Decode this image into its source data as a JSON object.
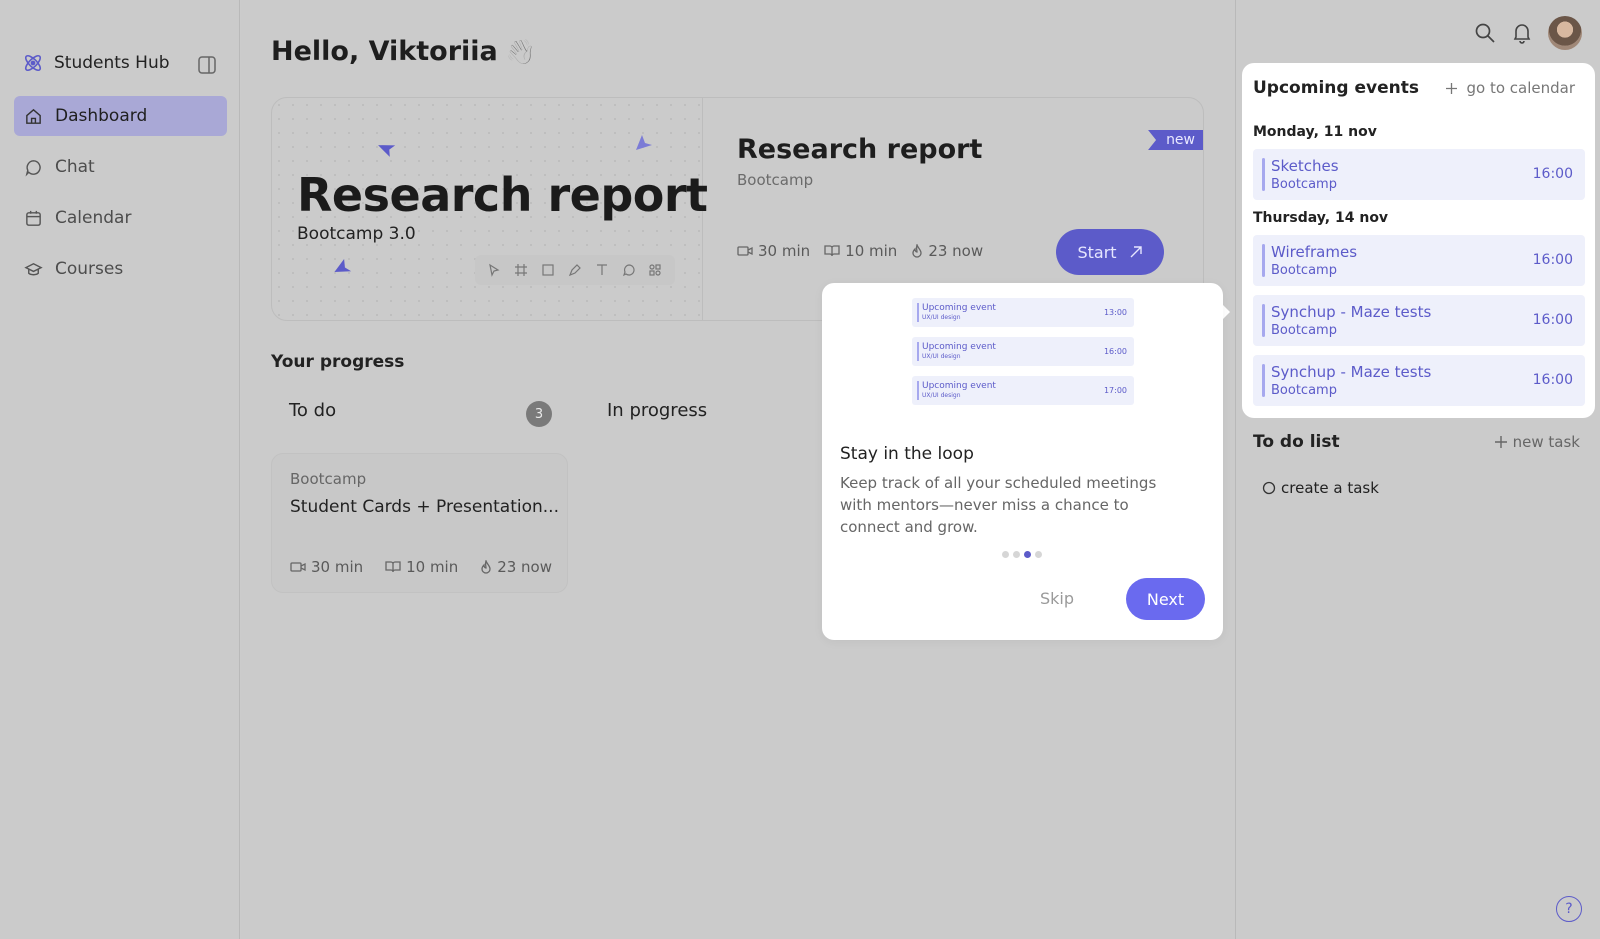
{
  "app": {
    "name": "Students Hub"
  },
  "sidebar": {
    "items": [
      {
        "label": "Dashboard",
        "icon": "home-icon",
        "active": true
      },
      {
        "label": "Chat",
        "icon": "chat-icon"
      },
      {
        "label": "Calendar",
        "icon": "calendar-icon"
      },
      {
        "label": "Courses",
        "icon": "graduation-cap-icon"
      }
    ]
  },
  "header": {
    "greeting": "Hello, Viktoriia",
    "emoji": "👋"
  },
  "hero": {
    "preview_title": "Research report",
    "preview_subtitle": "Bootcamp 3.0",
    "title": "Research report",
    "category": "Bootcamp",
    "badge": "new",
    "video_time": "30 min",
    "read_time": "10 min",
    "active_now": "23 now",
    "start_label": "Start"
  },
  "progress": {
    "title": "Your progress",
    "todo_label": "To do",
    "todo_count": "3",
    "in_progress_label": "In progress",
    "task": {
      "category": "Bootcamp",
      "title": "Student Cards + Presentation...",
      "video_time": "30 min",
      "read_time": "10 min",
      "active_now": "23 now"
    }
  },
  "events": {
    "title": "Upcoming events",
    "calendar_link": "go to calendar",
    "days": [
      {
        "label": "Monday, 11 nov"
      },
      {
        "label": "Thursday, 14 nov"
      }
    ],
    "items": [
      {
        "name": "Sketches",
        "sub": "Bootcamp",
        "time": "16:00"
      },
      {
        "name": "Wireframes",
        "sub": "Bootcamp",
        "time": "16:00"
      },
      {
        "name": "Synchup - Maze tests",
        "sub": "Bootcamp",
        "time": "16:00"
      },
      {
        "name": "Synchup - Maze tests",
        "sub": "Bootcamp",
        "time": "16:00"
      }
    ]
  },
  "todo": {
    "title": "To do list",
    "new_task": "new task",
    "items": [
      "create a task"
    ]
  },
  "onboarding": {
    "preview": [
      {
        "name": "Upcoming event",
        "sub": "UX/UI design",
        "time": "13:00"
      },
      {
        "name": "Upcoming event",
        "sub": "UX/UI design",
        "time": "16:00"
      },
      {
        "name": "Upcoming event",
        "sub": "UX/UI design",
        "time": "17:00"
      }
    ],
    "title": "Stay in the loop",
    "body": "Keep track of all your scheduled meetings with mentors—never miss a chance to connect and grow.",
    "step": 3,
    "steps_total": 4,
    "skip_label": "Skip",
    "next_label": "Next"
  },
  "help": {
    "label": "?"
  },
  "colors": {
    "accent": "#5c5bc9",
    "accent_light": "#eef0fb",
    "overlay": "#cbcbcb"
  }
}
